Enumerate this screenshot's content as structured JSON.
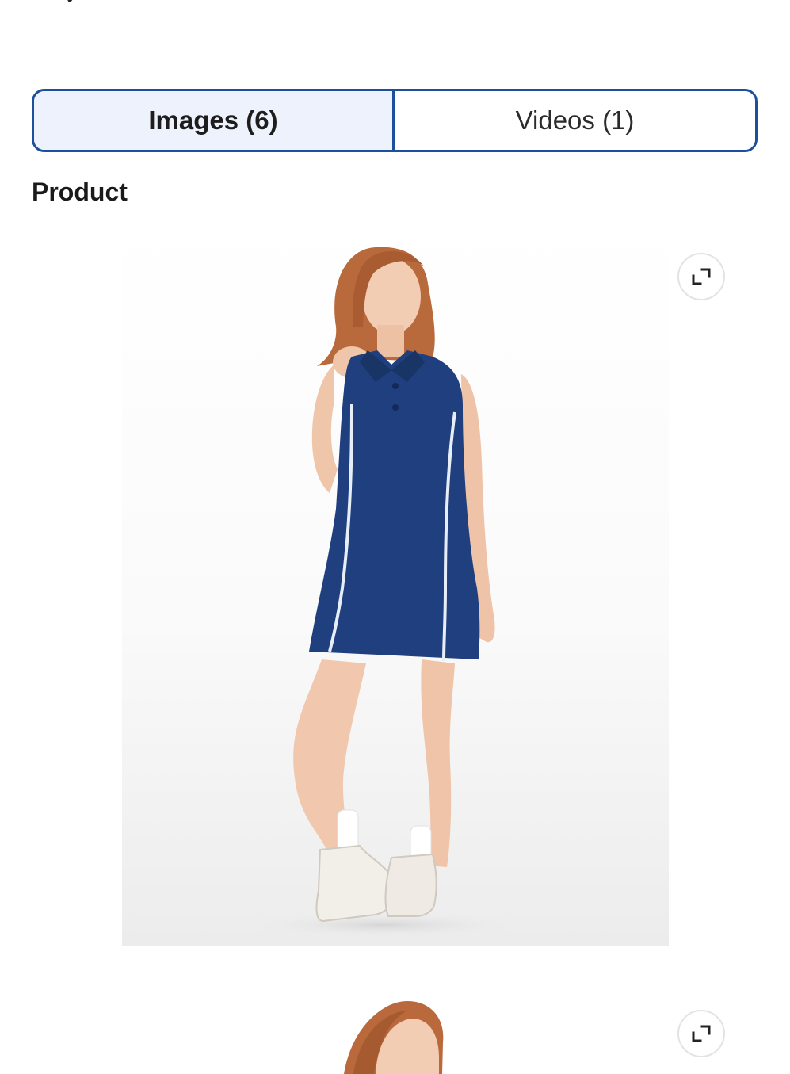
{
  "header": {
    "back_icon": "chevron-left-icon",
    "close_icon": "close-icon"
  },
  "tabs": {
    "images_label": "Images (6)",
    "videos_label": "Videos (1)",
    "active": "images"
  },
  "section": {
    "title": "Product"
  },
  "media": {
    "items": [
      {
        "type": "image",
        "expand_icon": "expand-icon"
      },
      {
        "type": "image",
        "expand_icon": "expand-icon"
      }
    ]
  },
  "colors": {
    "accent": "#1c4f9c",
    "active_tab_bg": "#eef2fc",
    "dress": "#1f3f7f",
    "piping": "#e8eef8"
  }
}
